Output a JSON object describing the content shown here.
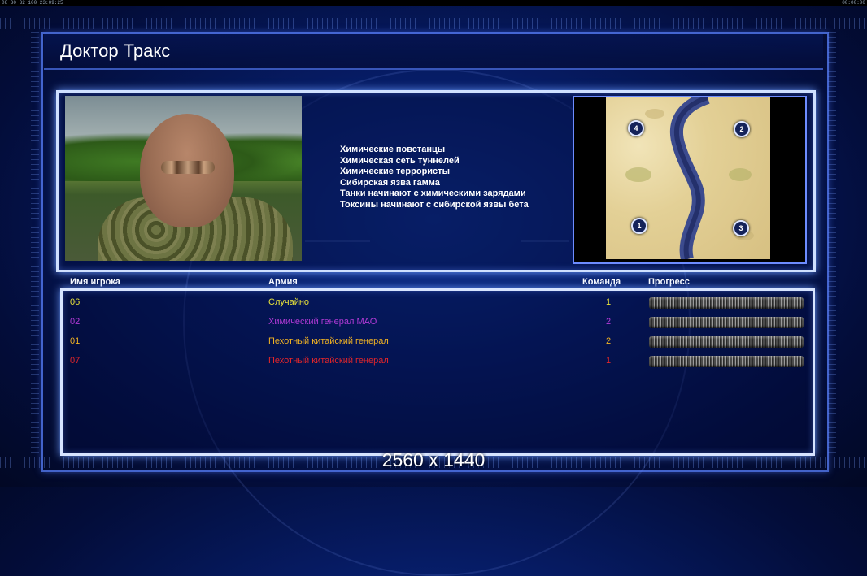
{
  "topbar": {
    "clock_left": "08 30 32 100 23:09:25",
    "clock_right": "00:00:00"
  },
  "screen": {
    "title": "Доктор Тракс"
  },
  "general": {
    "portrait": "general-portrait",
    "traits": [
      "Химические повстанцы",
      "Химическая сеть туннелей",
      "Химические террористы",
      "Сибирская язва гамма",
      "Танки начинают с химическими зарядами",
      "Токсины начинают с сибирской язвы бета"
    ]
  },
  "map": {
    "spawn_points": [
      "4",
      "2",
      "1",
      "3"
    ]
  },
  "table": {
    "headers": {
      "player": "Имя игрока",
      "army": "Армия",
      "team": "Команда",
      "progress": "Прогресс"
    },
    "rows": [
      {
        "player": "06",
        "army": "Случайно",
        "team": "1",
        "color": "#e8e23a",
        "progress": 1.0
      },
      {
        "player": "02",
        "army": "Химический генерал МАО",
        "team": "2",
        "color": "#b23ad6",
        "progress": 1.0
      },
      {
        "player": "01",
        "army": "Пехотный китайский генерал",
        "team": "2",
        "color": "#f0b223",
        "progress": 1.0
      },
      {
        "player": "07",
        "army": "Пехотный китайский генерал",
        "team": "1",
        "color": "#e3262a",
        "progress": 1.0
      }
    ]
  },
  "footer": {
    "resolution": "2560 x 1440"
  }
}
